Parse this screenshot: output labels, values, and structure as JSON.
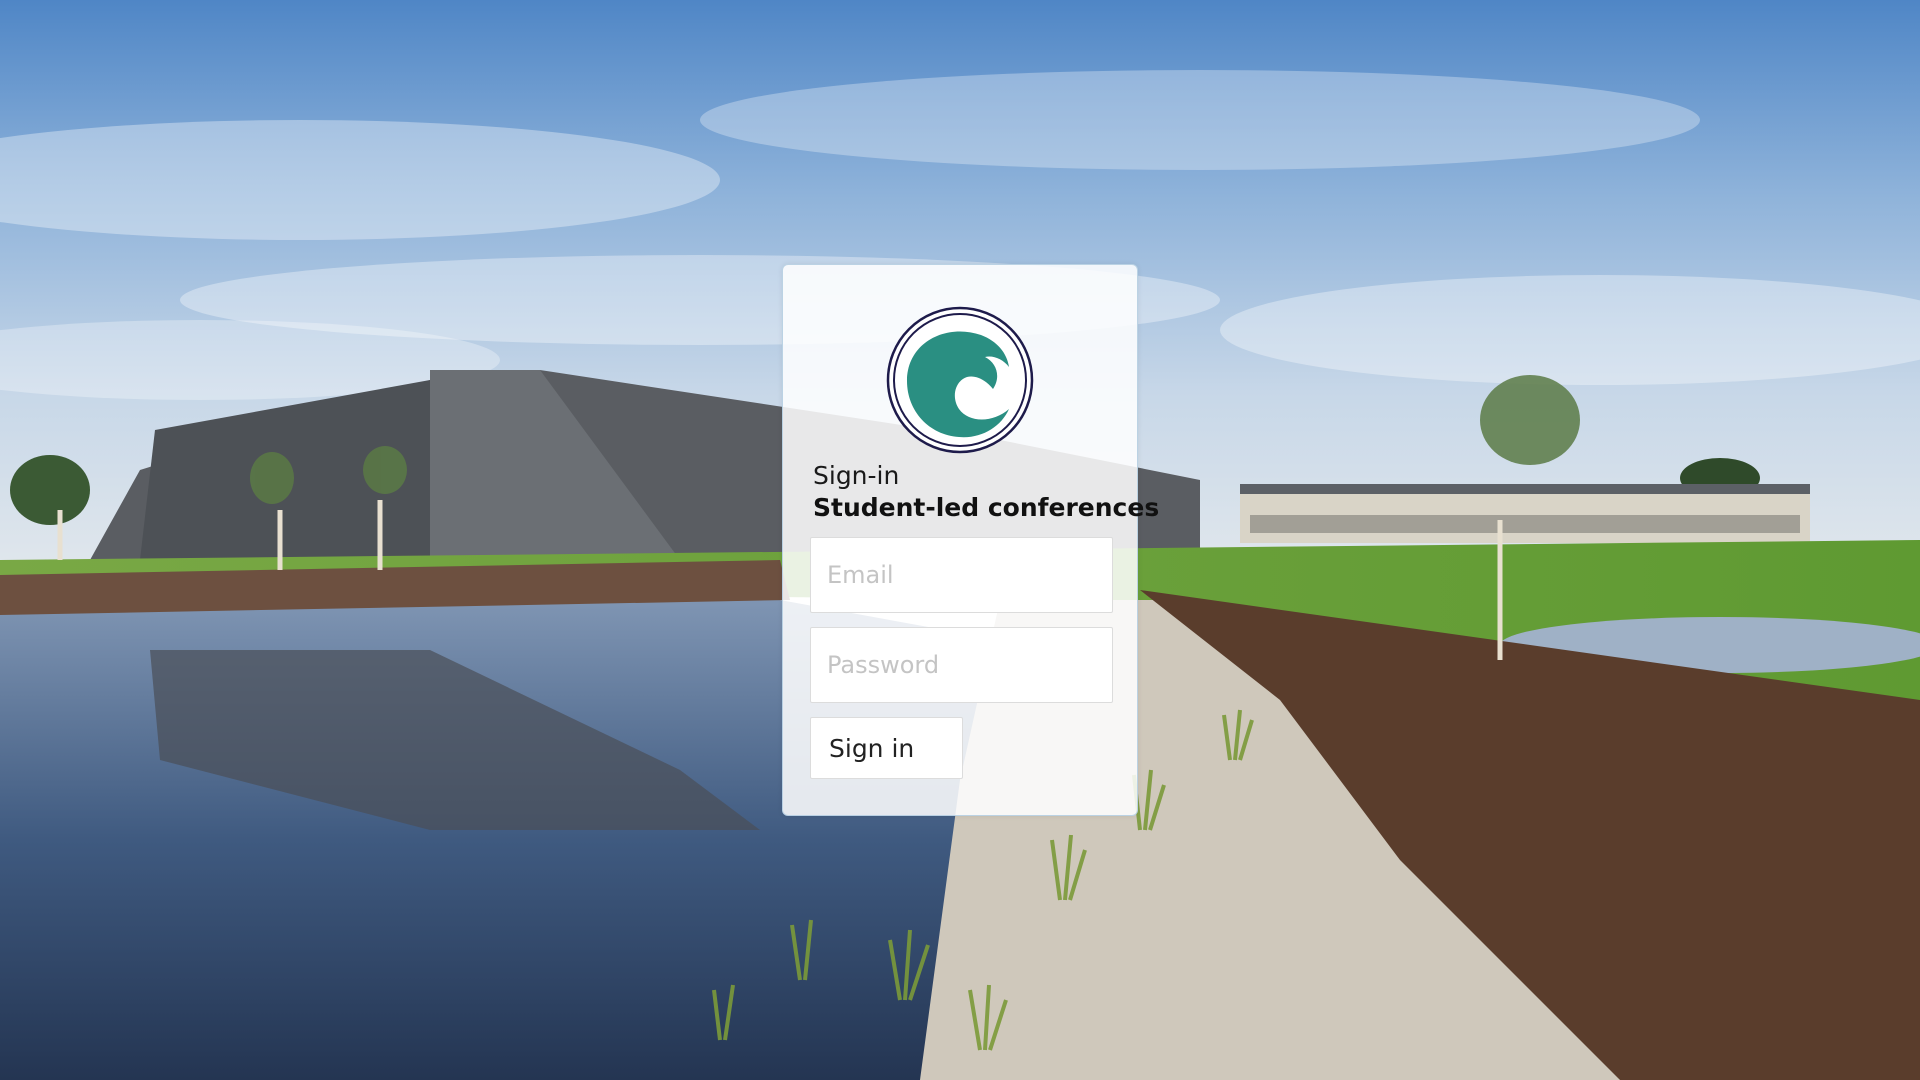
{
  "colors": {
    "logo_teal": "#2a8f82",
    "logo_ring": "#1e1b4b",
    "card_border": "#b4cde1"
  },
  "background": {
    "icon": "school-campus-photo"
  },
  "login": {
    "logo_icon": "wave-logo",
    "subtitle": "Sign-in",
    "title": "Student-led conferences",
    "email_placeholder": "Email",
    "password_placeholder": "Password",
    "signin_label": "Sign in"
  }
}
